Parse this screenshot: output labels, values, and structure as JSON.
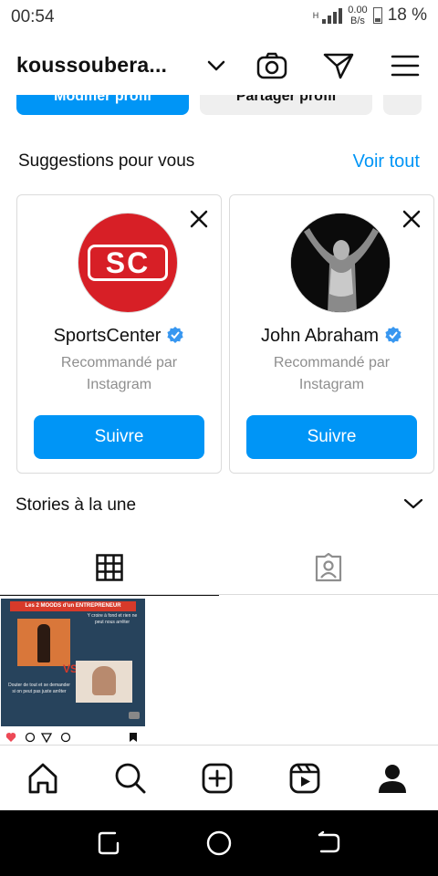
{
  "status_bar": {
    "time": "00:54",
    "network_type": "H",
    "data_rate_value": "0.00",
    "data_rate_unit": "B/s",
    "battery_percent": "18 %"
  },
  "header": {
    "username": "koussoubera...",
    "icons": [
      "chevron-down-icon",
      "camera-icon",
      "send-icon",
      "menu-icon"
    ]
  },
  "profile_actions": {
    "edit_label": "Modifier profil",
    "share_label": "Partager profil"
  },
  "suggestions": {
    "title": "Suggestions pour vous",
    "see_all": "Voir tout",
    "cards": [
      {
        "name": "SportsCenter",
        "logo_text": "SC",
        "subtitle_line1": "Recommandé par",
        "subtitle_line2": "Instagram",
        "button": "Suivre"
      },
      {
        "name": "John Abraham",
        "subtitle_line1": "Recommandé par",
        "subtitle_line2": "Instagram",
        "button": "Suivre"
      }
    ]
  },
  "stories": {
    "title": "Stories à la une"
  },
  "tabs": [
    "grid-icon",
    "tagged-icon"
  ],
  "post": {
    "banner": "Les 2 MOODS d'un ENTREPRENEUR",
    "caption1": "Y croire à fond et rien ne peut nous arrêter",
    "caption2": "Douter de tout et se demander si on peut pas juste arrêter",
    "vs": "VS"
  },
  "colors": {
    "accent": "#0095f6",
    "verified": "#3897f0",
    "sportscenter_red": "#d71f26"
  }
}
